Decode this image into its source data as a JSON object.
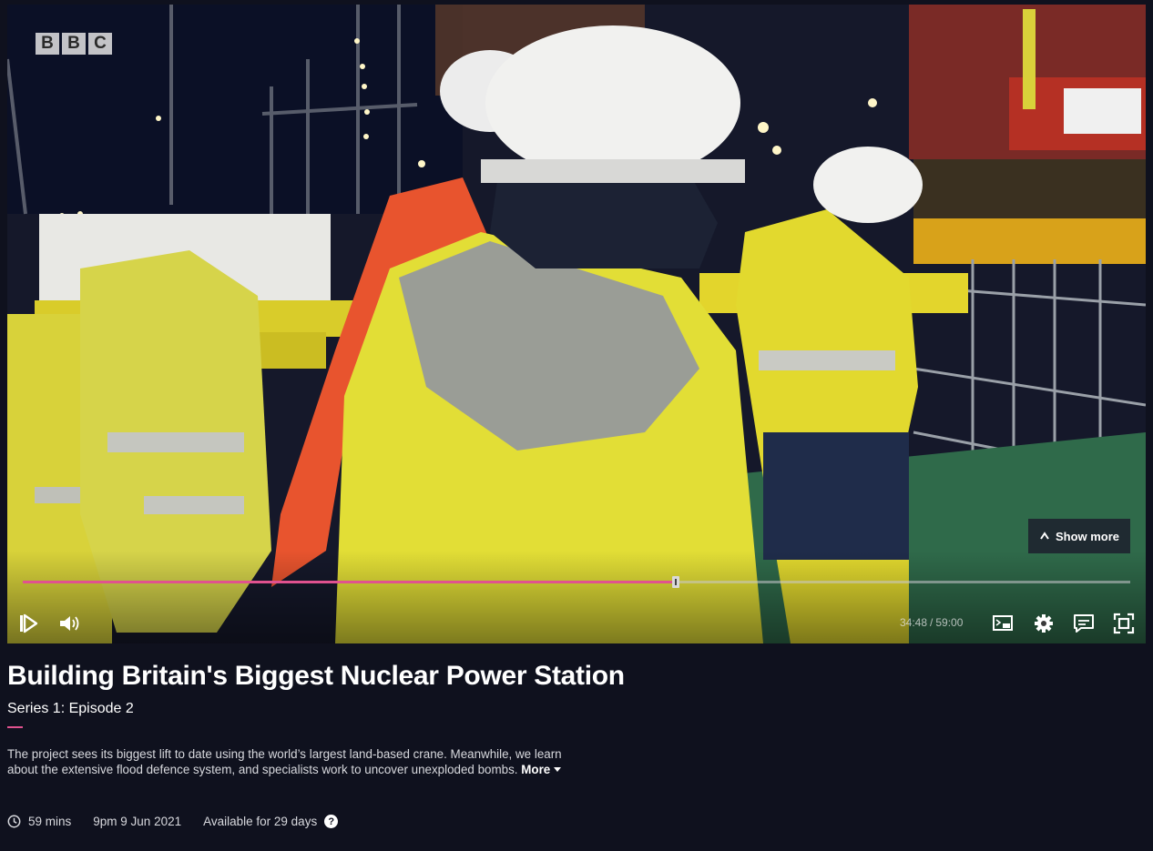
{
  "player": {
    "logo_letters": [
      "B",
      "B",
      "C"
    ],
    "show_more_label": "Show more",
    "progress_fraction": 0.59,
    "elapsed": "34:48",
    "separator": "/",
    "duration": "59:00",
    "accent_color": "#e0528f",
    "icons": {
      "play": "play-icon",
      "volume": "volume-icon",
      "cast": "cast-icon",
      "settings": "settings-gear-icon",
      "subtitles": "subtitles-icon",
      "fullscreen": "fullscreen-icon"
    }
  },
  "programme": {
    "title": "Building Britain's Biggest Nuclear Power Station",
    "subtitle": "Series 1: Episode 2",
    "synopsis": "The project sees its biggest lift to date using the world’s largest land-based crane. Meanwhile, we learn about the extensive flood defence system, and specialists work to uncover unexploded bombs.",
    "more_label": "More",
    "meta": {
      "duration": "59 mins",
      "broadcast": "9pm 9 Jun 2021",
      "availability": "Available for 29 days",
      "help_symbol": "?"
    }
  }
}
